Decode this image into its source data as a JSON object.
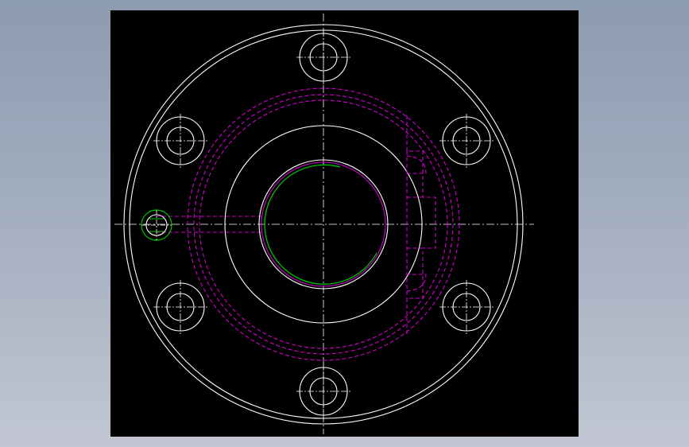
{
  "drawing": {
    "background": "#000000",
    "colors": {
      "outline": "#ffffff",
      "hidden": "#d000d0",
      "highlight": "#00c000",
      "centerline": "#ffffff"
    },
    "line_styles": {
      "centerline": "dash-dot",
      "hidden": "dashed"
    },
    "bolt_hole_count": 6,
    "icons": {
      "bolt": "bolt-hole-icon",
      "keyway": "keyway-icon"
    }
  }
}
